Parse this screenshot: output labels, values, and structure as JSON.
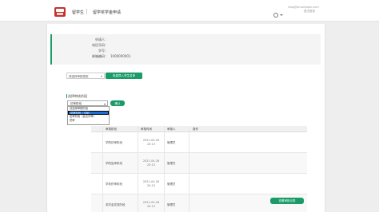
{
  "header": {
    "app_name": "留学生",
    "app_sub": "留学奖学金申请",
    "user_line1": "rebg@smartlogin.com",
    "user_line2": "退出登录"
  },
  "info": [
    {
      "label": "申请人：",
      "value": ""
    },
    {
      "label": "电话号码：",
      "value": ""
    },
    {
      "label": "学号：",
      "value": ""
    },
    {
      "label": "邮箱编码：",
      "value": "1000000001"
    }
  ],
  "filter": {
    "select_value": "请选择审核类型",
    "import_label": "批量导入学生名单"
  },
  "section": {
    "title": "选择审核阶段"
  },
  "dropdown": {
    "selected": "初审阶段",
    "confirm_label": "确认",
    "options": [
      {
        "label": "请选择审核阶段",
        "active": false
      },
      {
        "label": "初审阶段（当前）",
        "active": true
      },
      {
        "label": "复审阶段（会议评审）",
        "active": false
      },
      {
        "label": "终审",
        "active": false
      }
    ]
  },
  "table": {
    "headers": [
      "审核阶段",
      "审核时间",
      "审核人",
      "操作"
    ],
    "rows": [
      {
        "name": "学院初审阶段",
        "time1": "2021-04-26",
        "time2": "20:13",
        "by": "管理员",
        "action": ""
      },
      {
        "name": "学院复审阶段",
        "time1": "2021-04-26",
        "time2": "20:13",
        "by": "管理员",
        "action": ""
      },
      {
        "name": "学校终审阶段",
        "time1": "2021-04-26",
        "time2": "20:13",
        "by": "管理员",
        "action": ""
      },
      {
        "name": "奖学金发放阶段",
        "time1": "2021-04-26",
        "time2": "20:13",
        "by": "管理员",
        "action": "查看审核记录"
      }
    ]
  }
}
